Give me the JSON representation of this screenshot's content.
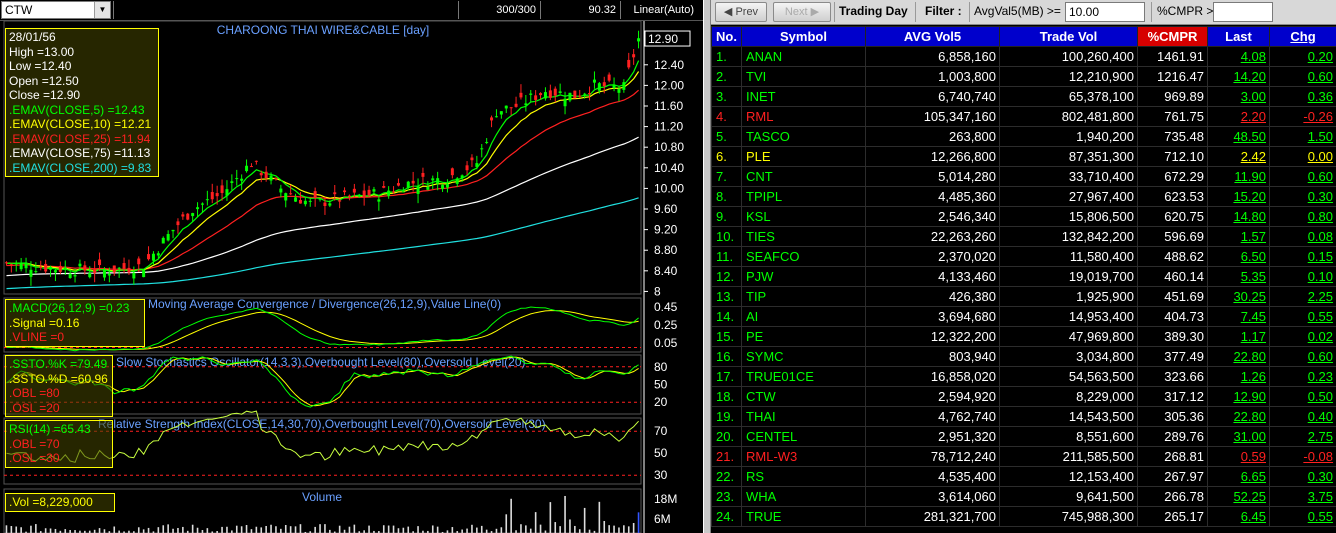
{
  "toolbar_left": {
    "symbol": "CTW",
    "bars": "300/300",
    "price": "90.32",
    "scale": "Linear(Auto)"
  },
  "chart": {
    "title": "CHAROONG THAI WIRE&CABLE [day]",
    "last_price_tag": "12.90",
    "info_lines": [
      {
        "text": "28/01/56",
        "color": "#ffffff"
      },
      {
        "text": "High  =13.00",
        "color": "#ffffff"
      },
      {
        "text": "Low  =12.40",
        "color": "#ffffff"
      },
      {
        "text": "Open  =12.50",
        "color": "#ffffff"
      },
      {
        "text": "Close  =12.90",
        "color": "#ffffff"
      },
      {
        "text": ".EMAV(CLOSE,5)    =12.43",
        "color": "#00ff00"
      },
      {
        "text": ".EMAV(CLOSE,10)    =12.21",
        "color": "#ffff00"
      },
      {
        "text": ".EMAV(CLOSE,25)    =11.94",
        "color": "#ff2020"
      },
      {
        "text": ".EMAV(CLOSE,75)    =11.13",
        "color": "#ffffff"
      },
      {
        "text": ".EMAV(CLOSE,200)   =9.83",
        "color": "#20e0e0"
      }
    ],
    "price_axis": [
      "12.40",
      "12.00",
      "11.60",
      "11.20",
      "10.80",
      "10.40",
      "10.00",
      "9.60",
      "9.20",
      "8.80",
      "8.40",
      "8"
    ],
    "price_range": [
      7.95,
      13.25
    ],
    "ema_colors": {
      "ema5": "#00ff00",
      "ema10": "#ffff00",
      "ema25": "#ff2020",
      "ema75": "#ffffff",
      "ema200": "#20e0e0"
    },
    "candle_up_color": "#00ff00",
    "candle_down_color": "#ff2020",
    "macd": {
      "title": "Moving Average Convergence / Divergence(26,12,9),Value Line(0)",
      "lines": [
        {
          "text": ".MACD(26,12,9)  =0.23",
          "color": "#00ff00"
        },
        {
          "text": ".Signal   =0.16",
          "color": "#ffff00"
        },
        {
          "text": ".VLINE    =0",
          "color": "#ff2020"
        }
      ],
      "axis": [
        "0.45",
        "0.25",
        "0.05"
      ]
    },
    "ssto": {
      "title": "Slow Stochastics Oscillator(14,3,3),Overbought Level(80),Oversold Level(20)",
      "lines": [
        {
          "text": ".SSTO.%K  =79.49",
          "color": "#00ff00"
        },
        {
          "text": ".SSTO.%D  =60.96",
          "color": "#ffff00"
        },
        {
          "text": ".OBL   =80",
          "color": "#ff2020"
        },
        {
          "text": ".OSL   =20",
          "color": "#ff2020"
        }
      ],
      "axis": [
        "80",
        "50",
        "20"
      ]
    },
    "rsi": {
      "title": "Relative Strength Index(CLOSE,14,30,70),Overbought Level(70),Oversold Level(30)",
      "lines": [
        {
          "text": "RSI(14)   =65.43",
          "color": "#00ff00"
        },
        {
          "text": ".OBL   =70",
          "color": "#ff2020"
        },
        {
          "text": ".OSL   =30",
          "color": "#ff2020"
        }
      ],
      "axis": [
        "70",
        "50",
        "30"
      ]
    },
    "volume": {
      "title": "Volume",
      "lines": [
        {
          "text": ".Vol   =8,229,000",
          "color": "#ffff00"
        }
      ],
      "axis": [
        "18M",
        "6M"
      ]
    }
  },
  "toolbar_right": {
    "prev_label": "Prev",
    "next_label": "Next",
    "trading_day_label": "Trading Day",
    "filter_label": "Filter :",
    "filter_field": "AvgVal5(MB) >=",
    "filter_value": "10.00",
    "cmpr_label": "%CMPR >=",
    "cmpr_value": ""
  },
  "table": {
    "headers": [
      "No.",
      "Symbol",
      "AVG Vol5",
      "Trade Vol",
      "%CMPR",
      "Last",
      "Chg"
    ],
    "rows": [
      {
        "no": "1.",
        "symbol": "ANAN",
        "avg": "6,858,160",
        "vol": "100,260,400",
        "cmpr": "1461.91",
        "last": "4.08",
        "chg": "0.20",
        "trend": "up"
      },
      {
        "no": "2.",
        "symbol": "TVI",
        "avg": "1,003,800",
        "vol": "12,210,900",
        "cmpr": "1216.47",
        "last": "14.20",
        "chg": "0.60",
        "trend": "up"
      },
      {
        "no": "3.",
        "symbol": "INET",
        "avg": "6,740,740",
        "vol": "65,378,100",
        "cmpr": "969.89",
        "last": "3.00",
        "chg": "0.36",
        "trend": "up"
      },
      {
        "no": "4.",
        "symbol": "RML",
        "avg": "105,347,160",
        "vol": "802,481,800",
        "cmpr": "761.75",
        "last": "2.20",
        "chg": "-0.26",
        "trend": "down"
      },
      {
        "no": "5.",
        "symbol": "TASCO",
        "avg": "263,800",
        "vol": "1,940,200",
        "cmpr": "735.48",
        "last": "48.50",
        "chg": "1.50",
        "trend": "up"
      },
      {
        "no": "6.",
        "symbol": "PLE",
        "avg": "12,266,800",
        "vol": "87,351,300",
        "cmpr": "712.10",
        "last": "2.42",
        "chg": "0.00",
        "trend": "flat"
      },
      {
        "no": "7.",
        "symbol": "CNT",
        "avg": "5,014,280",
        "vol": "33,710,400",
        "cmpr": "672.29",
        "last": "11.90",
        "chg": "0.60",
        "trend": "up"
      },
      {
        "no": "8.",
        "symbol": "TPIPL",
        "avg": "4,485,360",
        "vol": "27,967,400",
        "cmpr": "623.53",
        "last": "15.20",
        "chg": "0.30",
        "trend": "up"
      },
      {
        "no": "9.",
        "symbol": "KSL",
        "avg": "2,546,340",
        "vol": "15,806,500",
        "cmpr": "620.75",
        "last": "14.80",
        "chg": "0.80",
        "trend": "up"
      },
      {
        "no": "10.",
        "symbol": "TIES",
        "avg": "22,263,260",
        "vol": "132,842,200",
        "cmpr": "596.69",
        "last": "1.57",
        "chg": "0.08",
        "trend": "up"
      },
      {
        "no": "11.",
        "symbol": "SEAFCO",
        "avg": "2,370,020",
        "vol": "11,580,400",
        "cmpr": "488.62",
        "last": "6.50",
        "chg": "0.15",
        "trend": "up"
      },
      {
        "no": "12.",
        "symbol": "PJW",
        "avg": "4,133,460",
        "vol": "19,019,700",
        "cmpr": "460.14",
        "last": "5.35",
        "chg": "0.10",
        "trend": "up"
      },
      {
        "no": "13.",
        "symbol": "TIP",
        "avg": "426,380",
        "vol": "1,925,900",
        "cmpr": "451.69",
        "last": "30.25",
        "chg": "2.25",
        "trend": "up"
      },
      {
        "no": "14.",
        "symbol": "AI",
        "avg": "3,694,680",
        "vol": "14,953,400",
        "cmpr": "404.73",
        "last": "7.45",
        "chg": "0.55",
        "trend": "up"
      },
      {
        "no": "15.",
        "symbol": "PE",
        "avg": "12,322,200",
        "vol": "47,969,800",
        "cmpr": "389.30",
        "last": "1.17",
        "chg": "0.02",
        "trend": "up"
      },
      {
        "no": "16.",
        "symbol": "SYMC",
        "avg": "803,940",
        "vol": "3,034,800",
        "cmpr": "377.49",
        "last": "22.80",
        "chg": "0.60",
        "trend": "up"
      },
      {
        "no": "17.",
        "symbol": "TRUE01CE",
        "avg": "16,858,020",
        "vol": "54,563,500",
        "cmpr": "323.66",
        "last": "1.26",
        "chg": "0.23",
        "trend": "up"
      },
      {
        "no": "18.",
        "symbol": "CTW",
        "avg": "2,594,920",
        "vol": "8,229,000",
        "cmpr": "317.12",
        "last": "12.90",
        "chg": "0.50",
        "trend": "up"
      },
      {
        "no": "19.",
        "symbol": "THAI",
        "avg": "4,762,740",
        "vol": "14,543,500",
        "cmpr": "305.36",
        "last": "22.80",
        "chg": "0.40",
        "trend": "up"
      },
      {
        "no": "20.",
        "symbol": "CENTEL",
        "avg": "2,951,320",
        "vol": "8,551,600",
        "cmpr": "289.76",
        "last": "31.00",
        "chg": "2.75",
        "trend": "up"
      },
      {
        "no": "21.",
        "symbol": "RML-W3",
        "avg": "78,712,240",
        "vol": "211,585,500",
        "cmpr": "268.81",
        "last": "0.59",
        "chg": "-0.08",
        "trend": "down"
      },
      {
        "no": "22.",
        "symbol": "RS",
        "avg": "4,535,400",
        "vol": "12,153,400",
        "cmpr": "267.97",
        "last": "6.65",
        "chg": "0.30",
        "trend": "up"
      },
      {
        "no": "23.",
        "symbol": "WHA",
        "avg": "3,614,060",
        "vol": "9,641,500",
        "cmpr": "266.78",
        "last": "52.25",
        "chg": "3.75",
        "trend": "up"
      },
      {
        "no": "24.",
        "symbol": "TRUE",
        "avg": "281,321,700",
        "vol": "745,988,300",
        "cmpr": "265.17",
        "last": "6.45",
        "chg": "0.55",
        "trend": "up"
      }
    ]
  }
}
